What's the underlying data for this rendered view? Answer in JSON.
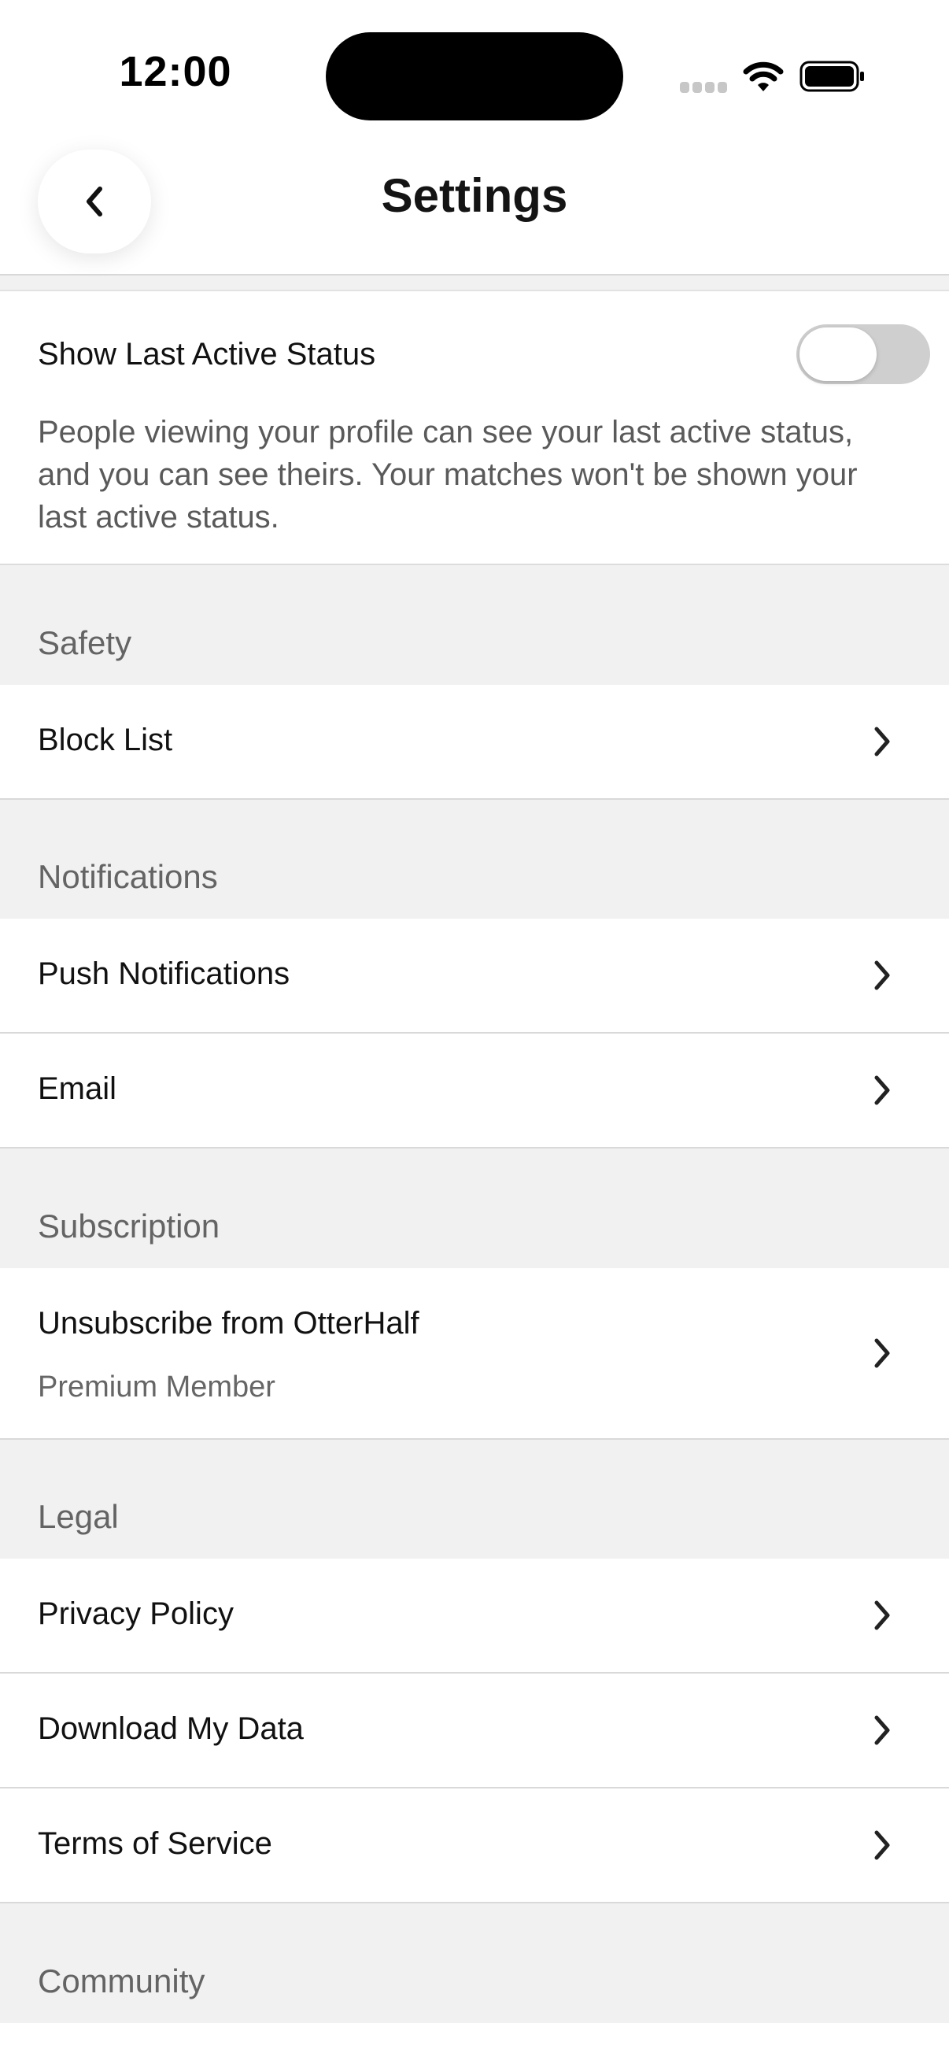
{
  "status_bar": {
    "time": "12:00"
  },
  "header": {
    "title": "Settings",
    "back_icon": "chevron-left-icon"
  },
  "last_active": {
    "label": "Show Last Active Status",
    "enabled": false,
    "description": "People viewing your profile can see your last active status, and you can see theirs. Your matches won't be shown your last active status."
  },
  "sections": {
    "safety": {
      "title": "Safety",
      "items": [
        {
          "label": "Block List"
        }
      ]
    },
    "notifications": {
      "title": "Notifications",
      "items": [
        {
          "label": "Push Notifications"
        },
        {
          "label": "Email"
        }
      ]
    },
    "subscription": {
      "title": "Subscription",
      "items": [
        {
          "label": "Unsubscribe from OtterHalf",
          "sublabel": "Premium Member"
        }
      ]
    },
    "legal": {
      "title": "Legal",
      "items": [
        {
          "label": "Privacy Policy"
        },
        {
          "label": "Download My Data"
        },
        {
          "label": "Terms of Service"
        }
      ]
    },
    "community": {
      "title": "Community"
    }
  },
  "colors": {
    "page_background": "#f1f1f1",
    "card_background": "#ffffff",
    "section_text": "#646464",
    "toggle_off": "#cfcfcf"
  }
}
